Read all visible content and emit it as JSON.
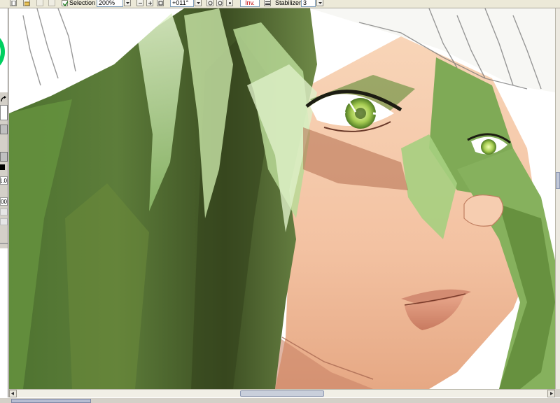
{
  "toolbar": {
    "selection_label": "Selection",
    "selection_checked": true,
    "zoom_value": "200%",
    "rotation_value": "+011°",
    "invert_label": "Inv.",
    "stabilizer_label": "Stabilizer",
    "stabilizer_value": "3"
  },
  "left_panel": {
    "size_value_1": "1.0",
    "size_value_2": "00"
  },
  "colors": {
    "accent_green": "#00d060",
    "hair_dark": "#3f5a20",
    "hair_light": "#cfe8b0",
    "skin": "#f2c4a4",
    "window_bg": "#ece9d8"
  },
  "scroll": {
    "vertical_fraction": 0.45,
    "horizontal_fraction": 0.5
  }
}
